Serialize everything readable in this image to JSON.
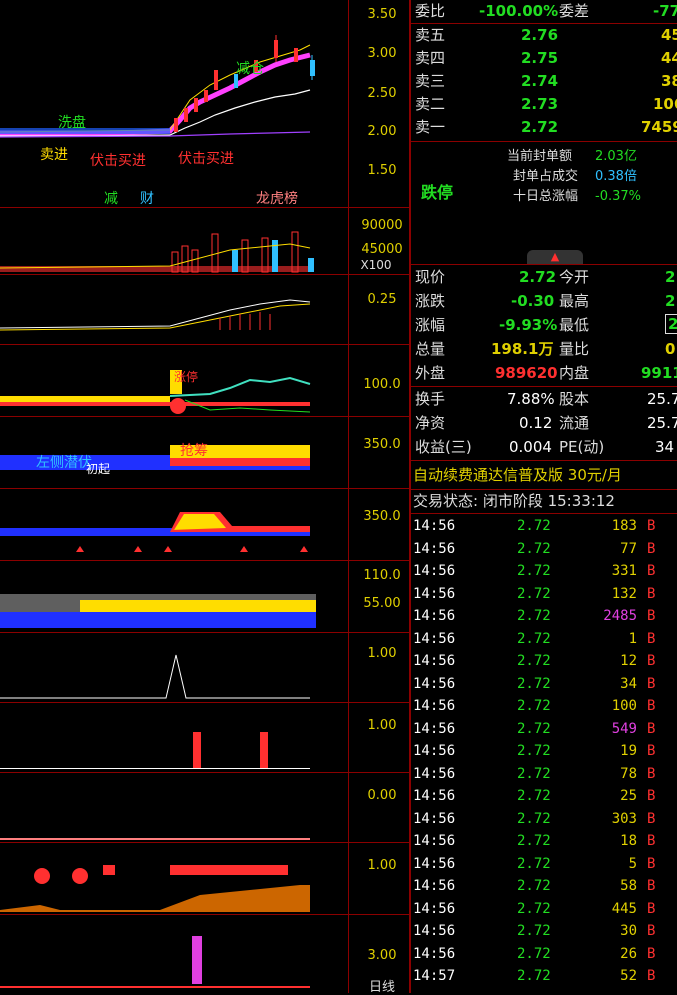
{
  "chart_axis": {
    "main": [
      "3.50",
      "3.00",
      "2.50",
      "2.00",
      "1.50"
    ],
    "vol": [
      "90000",
      "45000",
      "X100"
    ],
    "ind1": [
      "0.25"
    ],
    "ind2": [
      "100.0"
    ],
    "ind3": [
      "350.0"
    ],
    "ind4": [
      "350.0"
    ],
    "ind5": [
      "110.0",
      "55.00"
    ],
    "ind6": [
      "1.00"
    ],
    "ind7": [
      "1.00"
    ],
    "ind8": [
      "0.00"
    ],
    "ind9": [
      "1.00"
    ],
    "ind10": [
      "3.00"
    ],
    "bottom_label": "日线"
  },
  "chart_labels": {
    "wash": "洗盘",
    "sell_in": "卖进",
    "ambush_buy1": "伏击买进",
    "ambush_buy2": "伏击买进",
    "reduce": "减",
    "wealth": "财",
    "dragon_tiger": "龙虎榜",
    "reduce2": "减仓",
    "left_side": "左侧潜伏",
    "early_stage": "初起",
    "rush": "抢筹",
    "up_limit": "涨停"
  },
  "order_book": {
    "weibi_label": "委比",
    "weibi_value": "-100.00%",
    "weicha_label": "委差",
    "weicha_value": "-77",
    "sells": [
      {
        "label": "卖五",
        "price": "2.76",
        "vol": "45"
      },
      {
        "label": "卖四",
        "price": "2.75",
        "vol": "44"
      },
      {
        "label": "卖三",
        "price": "2.74",
        "vol": "38"
      },
      {
        "label": "卖二",
        "price": "2.73",
        "vol": "106"
      },
      {
        "label": "卖一",
        "price": "2.72",
        "vol": "7459"
      }
    ]
  },
  "limit_box": {
    "status": "跌停",
    "seal_amount_label": "当前封单额",
    "seal_amount_value": "2.03亿",
    "seal_ratio_label": "封单占成交",
    "seal_ratio_value": "0.38倍",
    "ten_day_label": "十日总涨幅",
    "ten_day_value": "-0.37%"
  },
  "quote": {
    "rows": [
      {
        "l1": "现价",
        "v1": "2.72",
        "l2": "今开",
        "v2": "2"
      },
      {
        "l1": "涨跌",
        "v1": "-0.30",
        "l2": "最高",
        "v2": "2"
      },
      {
        "l1": "涨幅",
        "v1": "-9.93%",
        "l2": "最低",
        "v2": "2"
      },
      {
        "l1": "总量",
        "v1": "198.1万",
        "l2": "量比",
        "v2": "0"
      },
      {
        "l1": "外盘",
        "v1": "989620",
        "l2": "内盘",
        "v2": "9911"
      }
    ],
    "rows2": [
      {
        "l1": "换手",
        "v1": "7.88%",
        "l2": "股本",
        "v2": "25.7"
      },
      {
        "l1": "净资",
        "v1": "0.12",
        "l2": "流通",
        "v2": "25.7"
      },
      {
        "l1": "收益(三)",
        "v1": "0.004",
        "l2": "PE(动)",
        "v2": "34"
      }
    ]
  },
  "ad_banner": "自动续费通达信普及版  30元/月",
  "trade_status": "交易状态: 闭市阶段 15:33:12",
  "ticks": [
    {
      "t": "14:56",
      "p": "2.72",
      "v": "183",
      "s": "B",
      "vc": "y"
    },
    {
      "t": "14:56",
      "p": "2.72",
      "v": "77",
      "s": "B",
      "vc": "y"
    },
    {
      "t": "14:56",
      "p": "2.72",
      "v": "331",
      "s": "B",
      "vc": "y"
    },
    {
      "t": "14:56",
      "p": "2.72",
      "v": "132",
      "s": "B",
      "vc": "y"
    },
    {
      "t": "14:56",
      "p": "2.72",
      "v": "2485",
      "s": "B",
      "vc": "m"
    },
    {
      "t": "14:56",
      "p": "2.72",
      "v": "1",
      "s": "B",
      "vc": "y"
    },
    {
      "t": "14:56",
      "p": "2.72",
      "v": "12",
      "s": "B",
      "vc": "y"
    },
    {
      "t": "14:56",
      "p": "2.72",
      "v": "34",
      "s": "B",
      "vc": "y"
    },
    {
      "t": "14:56",
      "p": "2.72",
      "v": "100",
      "s": "B",
      "vc": "y"
    },
    {
      "t": "14:56",
      "p": "2.72",
      "v": "549",
      "s": "B",
      "vc": "m"
    },
    {
      "t": "14:56",
      "p": "2.72",
      "v": "19",
      "s": "B",
      "vc": "y"
    },
    {
      "t": "14:56",
      "p": "2.72",
      "v": "78",
      "s": "B",
      "vc": "y"
    },
    {
      "t": "14:56",
      "p": "2.72",
      "v": "25",
      "s": "B",
      "vc": "y"
    },
    {
      "t": "14:56",
      "p": "2.72",
      "v": "303",
      "s": "B",
      "vc": "y"
    },
    {
      "t": "14:56",
      "p": "2.72",
      "v": "18",
      "s": "B",
      "vc": "y"
    },
    {
      "t": "14:56",
      "p": "2.72",
      "v": "5",
      "s": "B",
      "vc": "y"
    },
    {
      "t": "14:56",
      "p": "2.72",
      "v": "58",
      "s": "B",
      "vc": "y"
    },
    {
      "t": "14:56",
      "p": "2.72",
      "v": "445",
      "s": "B",
      "vc": "y"
    },
    {
      "t": "14:56",
      "p": "2.72",
      "v": "30",
      "s": "B",
      "vc": "y"
    },
    {
      "t": "14:56",
      "p": "2.72",
      "v": "26",
      "s": "B",
      "vc": "y"
    },
    {
      "t": "14:57",
      "p": "2.72",
      "v": "52",
      "s": "B",
      "vc": "y"
    }
  ],
  "colors": {
    "accent_red": "#ff3030",
    "green": "#22dd22",
    "yellow": "#e0d000",
    "divider": "#8b0000"
  }
}
